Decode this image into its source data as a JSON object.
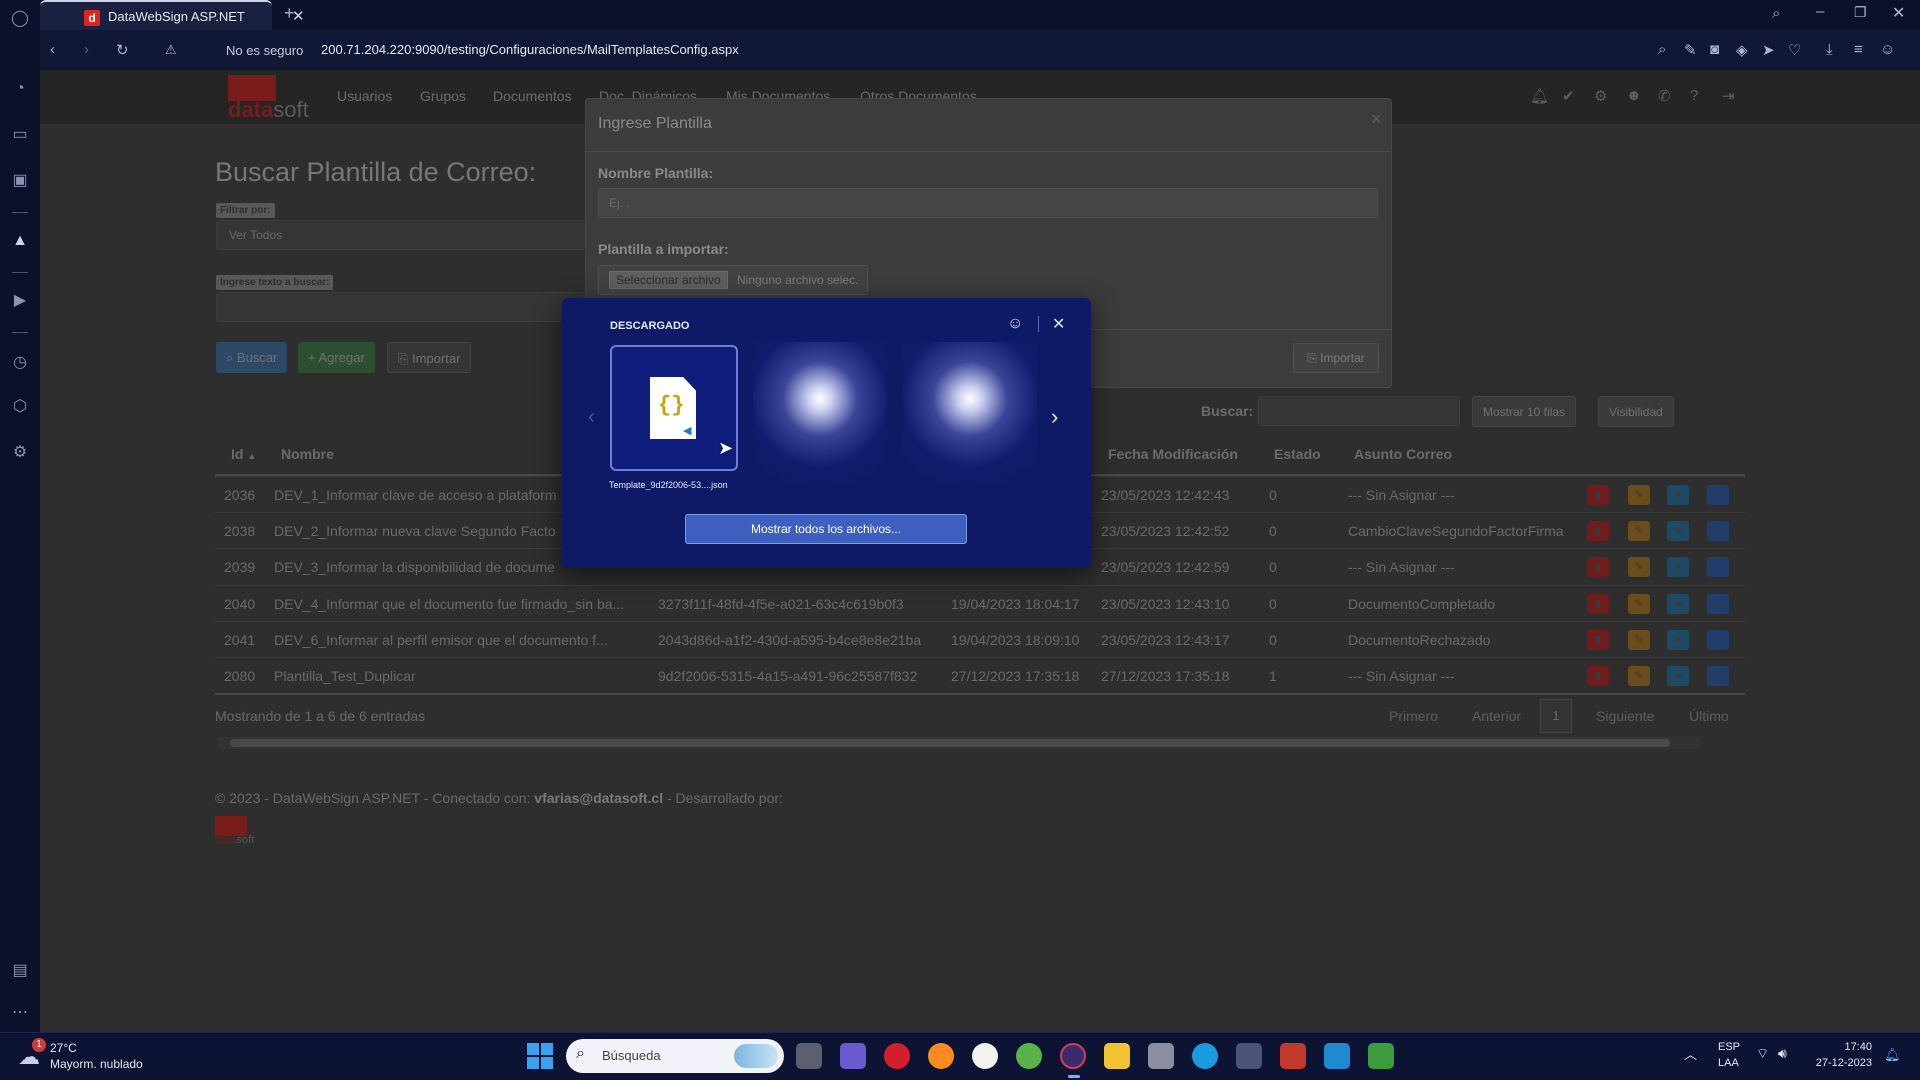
{
  "browser": {
    "tab_title": "DataWebSign ASP.NET",
    "tab_favicon": "d",
    "security_label": "No es seguro",
    "url": "200.71.204.220:9090/testing/Configuraciones/MailTemplatesConfig.aspx"
  },
  "site": {
    "logo_main": "data",
    "logo_accent": "soft",
    "nav": [
      "Usuarios",
      "Grupos",
      "Documentos",
      "Doc. Dinámicos",
      "Mis Documentos",
      "Otros Documentos"
    ]
  },
  "search_page": {
    "title": "Buscar Plantilla de Correo:",
    "filter_label": "Filtrar por:",
    "filter_value": "Ver Todos",
    "text_label": "Ingrese texto a buscar:",
    "buttons": {
      "search": "Buscar",
      "add": "Agregar",
      "import": "Importar"
    },
    "table_search_label": "Buscar:",
    "show_rows": "Mostrar 10 filas",
    "visibility": "Visibilidad"
  },
  "table": {
    "headers": [
      "Id",
      "Nombre",
      "Fecha Modificación",
      "Estado",
      "Asunto Correo"
    ],
    "rows": [
      {
        "id": "2036",
        "nombre": "DEV_1_Informar clave de acceso a plataform",
        "guid": "",
        "creado": "",
        "modificado": "23/05/2023 12:42:43",
        "estado": "0",
        "asunto": "--- Sin Asignar ---"
      },
      {
        "id": "2038",
        "nombre": "DEV_2_Informar nueva clave Segundo Facto",
        "guid": "",
        "creado": "",
        "modificado": "23/05/2023 12:42:52",
        "estado": "0",
        "asunto": "CambioClaveSegundoFactorFirma"
      },
      {
        "id": "2039",
        "nombre": "DEV_3_Informar la disponibilidad de docume",
        "guid": "",
        "creado": "",
        "modificado": "23/05/2023 12:42:59",
        "estado": "0",
        "asunto": "--- Sin Asignar ---"
      },
      {
        "id": "2040",
        "nombre": "DEV_4_Informar que el documento fue firmado_sin ba...",
        "guid": "3273f11f-48fd-4f5e-a021-63c4c619b0f3",
        "creado": "19/04/2023 18:04:17",
        "modificado": "23/05/2023 12:43:10",
        "estado": "0",
        "asunto": "DocumentoCompletado"
      },
      {
        "id": "2041",
        "nombre": "DEV_6_Informar al perfil emisor que el documento f...",
        "guid": "2043d86d-a1f2-430d-a595-b4ce8e8e21ba",
        "creado": "19/04/2023 18:09:10",
        "modificado": "23/05/2023 12:43:17",
        "estado": "0",
        "asunto": "DocumentoRechazado"
      },
      {
        "id": "2080",
        "nombre": "Plantilla_Test_Duplicar",
        "guid": "9d2f2006-5315-4a15-a491-96c25587f832",
        "creado": "27/12/2023 17:35:18",
        "modificado": "27/12/2023 17:35:18",
        "estado": "1",
        "asunto": "--- Sin Asignar ---"
      }
    ],
    "info": "Mostrando de 1 a 6 de 6 entradas",
    "pager": {
      "first": "Primero",
      "prev": "Anterior",
      "page": "1",
      "next": "Siguiente",
      "last": "Último"
    }
  },
  "footer": {
    "prefix": "© 2023 - DataWebSign ASP.NET - Conectado con:",
    "user": "vfarias@datasoft.cl",
    "suffix": "- Desarrollado por:"
  },
  "modal": {
    "title": "Ingrese Plantilla",
    "close": "×",
    "name_label": "Nombre Plantilla:",
    "name_placeholder": "Ej. .",
    "file_label": "Plantilla a importar:",
    "file_button": "Seleccionar archivo",
    "file_status": "Ninguno archivo selec.",
    "import_button": "Importar"
  },
  "download_popup": {
    "title": "DESCARGADO",
    "file_name": "Template_9d2f2006-53....json",
    "file_icon": "json-file-icon",
    "show_all": "Mostrar todos los archivos..."
  },
  "taskbar": {
    "weather_temp": "27°C",
    "weather_desc": "Mayorm. nublado",
    "weather_badge": "1",
    "search_placeholder": "Búsqueda",
    "lang1": "ESP",
    "lang2": "LAA",
    "time": "17:40",
    "date": "27-12-2023"
  },
  "colors": {
    "modal_bg": "#3c3c3c",
    "popup_bg": "#0f1a66",
    "accent_blue": "#3d5fbf",
    "danger": "#8a2020"
  }
}
